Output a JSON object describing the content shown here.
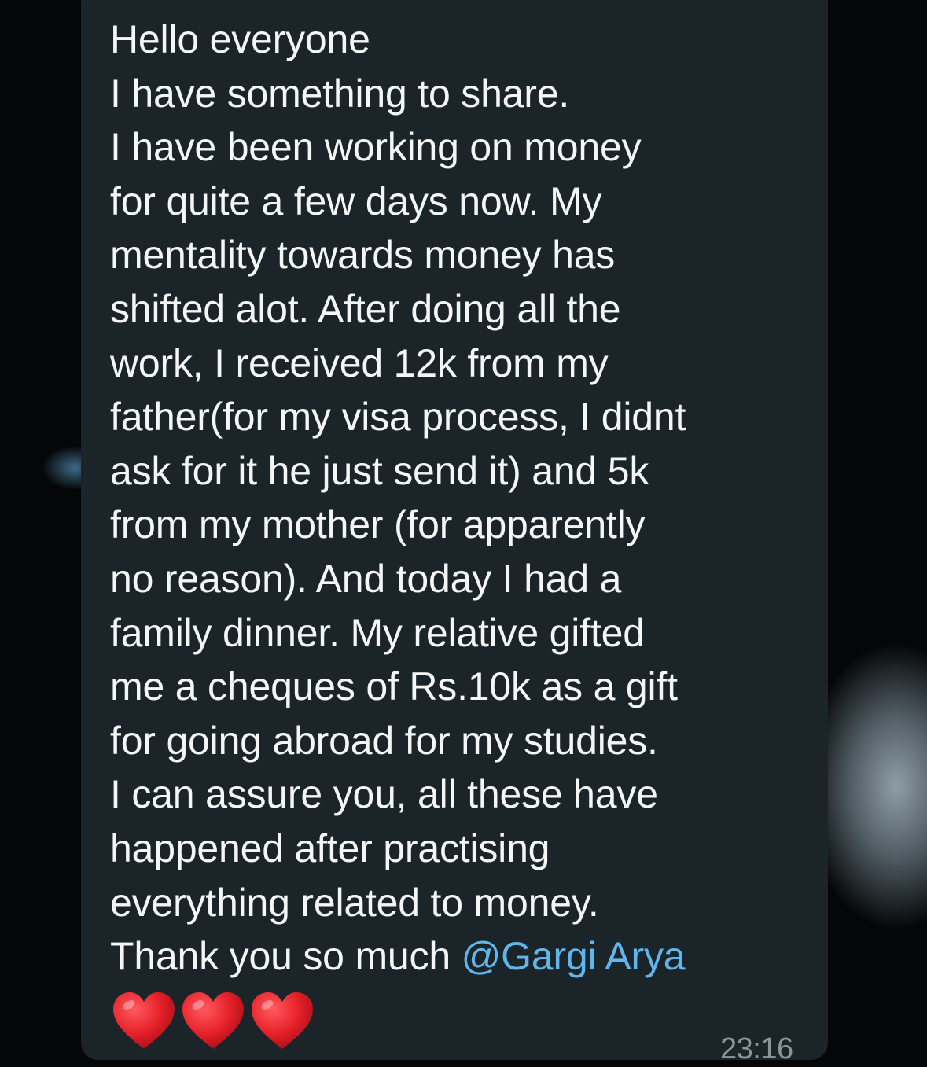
{
  "message": {
    "text": "Hello everyone\nI have something to share.\nI have been working on money\nfor quite a few days now. My\nmentality towards money has\nshifted alot. After doing all the\nwork, I received 12k from my\nfather(for my visa process, I didnt\nask for it he just send it) and 5k\nfrom my mother (for apparently\nno reason). And today I had a\nfamily dinner. My relative gifted\nme a cheques of Rs.10k as a gift\nfor going abroad for my studies.\nI can assure you, all these have\nhappened after practising\neverything related to money.\nThank you so much ",
    "mention": "@Gargi Arya",
    "reaction_icons": [
      "red-heart-icon",
      "red-heart-icon",
      "red-heart-icon"
    ],
    "time": "23:16"
  },
  "colors": {
    "bubble": "#1b2429",
    "text": "#f4f6f6",
    "mention": "#5fb6ec",
    "timestamp": "#8b969b",
    "heart": "#e8222b"
  }
}
